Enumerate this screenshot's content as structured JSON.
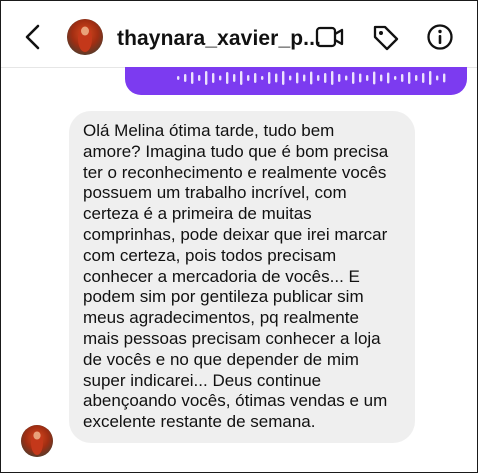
{
  "header": {
    "back_icon": "chevron-left-icon",
    "username": "thaynara_xavier_p...",
    "icons": [
      "video-camera-icon",
      "tag-icon",
      "info-icon"
    ]
  },
  "sent_voice_message": {
    "color": "#7c3bf0"
  },
  "incoming_message": {
    "bubble_color": "#efefef",
    "lines": [
      "Olá Melina ótima tarde, tudo bem",
      "amore? Imagina tudo que é bom precisa",
      "ter o reconhecimento e realmente vocês",
      "possuem um trabalho incrível, com",
      "certeza é a primeira de muitas",
      "comprinhas, pode deixar que irei marcar",
      "com certeza, pois todos precisam",
      "conhecer a mercadoria de vocês... E",
      "podem sim por gentileza publicar sim",
      "meus agradecimentos, pq realmente",
      "mais pessoas precisam conhecer a loja",
      "de vocês e no que depender de mim",
      "super indicarei... Deus continue",
      "abençoando vocês, ótimas vendas e um",
      "excelente restante de semana."
    ]
  }
}
